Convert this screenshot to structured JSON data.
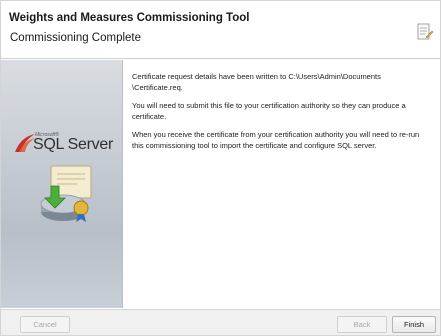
{
  "window": {
    "title": "Weights and Measures Commissioning Tool",
    "subtitle": "Commissioning Complete"
  },
  "sidebar": {
    "logo_vendor": "Microsoft®",
    "logo_product": "SQL Server"
  },
  "content": {
    "paragraphs": [
      "Certificate request details have been written to C:\\Users\\Admin\\Documents \\Certificate.req.",
      "You will need to submit this file to your certification authority so they can produce a certificate.",
      "When you receive the certificate from your certification authority you will need to re-run this commissioning tool to import the certificate and configure SQL server."
    ]
  },
  "buttons": {
    "cancel": "Cancel",
    "back": "Back",
    "finish": "Finish"
  },
  "icons": {
    "header": "wizard-document-icon",
    "sidebar_art": "certificate-download-icon"
  }
}
